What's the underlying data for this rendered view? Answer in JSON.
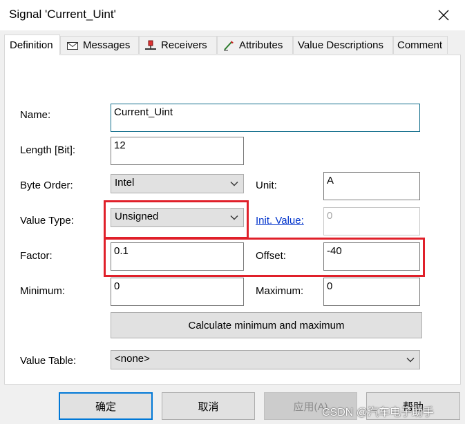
{
  "window": {
    "title": "Signal 'Current_Uint'"
  },
  "tabs": [
    {
      "label": "Definition",
      "icon": null,
      "active": true
    },
    {
      "label": "Messages",
      "icon": "envelope-icon",
      "active": false
    },
    {
      "label": "Receivers",
      "icon": "receiver-node-icon",
      "active": false
    },
    {
      "label": "Attributes",
      "icon": "attributes-pen-icon",
      "active": false
    },
    {
      "label": "Value Descriptions",
      "icon": null,
      "active": false
    },
    {
      "label": "Comment",
      "icon": null,
      "active": false
    }
  ],
  "form": {
    "name": {
      "label": "Name:",
      "value": "Current_Uint"
    },
    "length": {
      "label": "Length [Bit]:",
      "value": "12"
    },
    "byte_order": {
      "label": "Byte Order:",
      "value": "Intel"
    },
    "unit": {
      "label": "Unit:",
      "value": "A"
    },
    "value_type": {
      "label": "Value Type:",
      "value": "Unsigned"
    },
    "init_value": {
      "label": "Init. Value:",
      "value": "0"
    },
    "factor": {
      "label": "Factor:",
      "value": "0.1"
    },
    "offset": {
      "label": "Offset:",
      "value": "-40"
    },
    "minimum": {
      "label": "Minimum:",
      "value": "0"
    },
    "maximum": {
      "label": "Maximum:",
      "value": "0"
    },
    "calc_button": "Calculate minimum and maximum",
    "value_table": {
      "label": "Value Table:",
      "value": "<none>"
    }
  },
  "footer": {
    "ok": "确定",
    "cancel": "取消",
    "apply": "应用(A)",
    "help": "帮助"
  },
  "watermark": "CSDN @汽车电子助手",
  "colors": {
    "highlight": "#e0202a",
    "link": "#0033cc",
    "focus_border": "#0f6c8a",
    "primary_border": "#0078d7"
  }
}
